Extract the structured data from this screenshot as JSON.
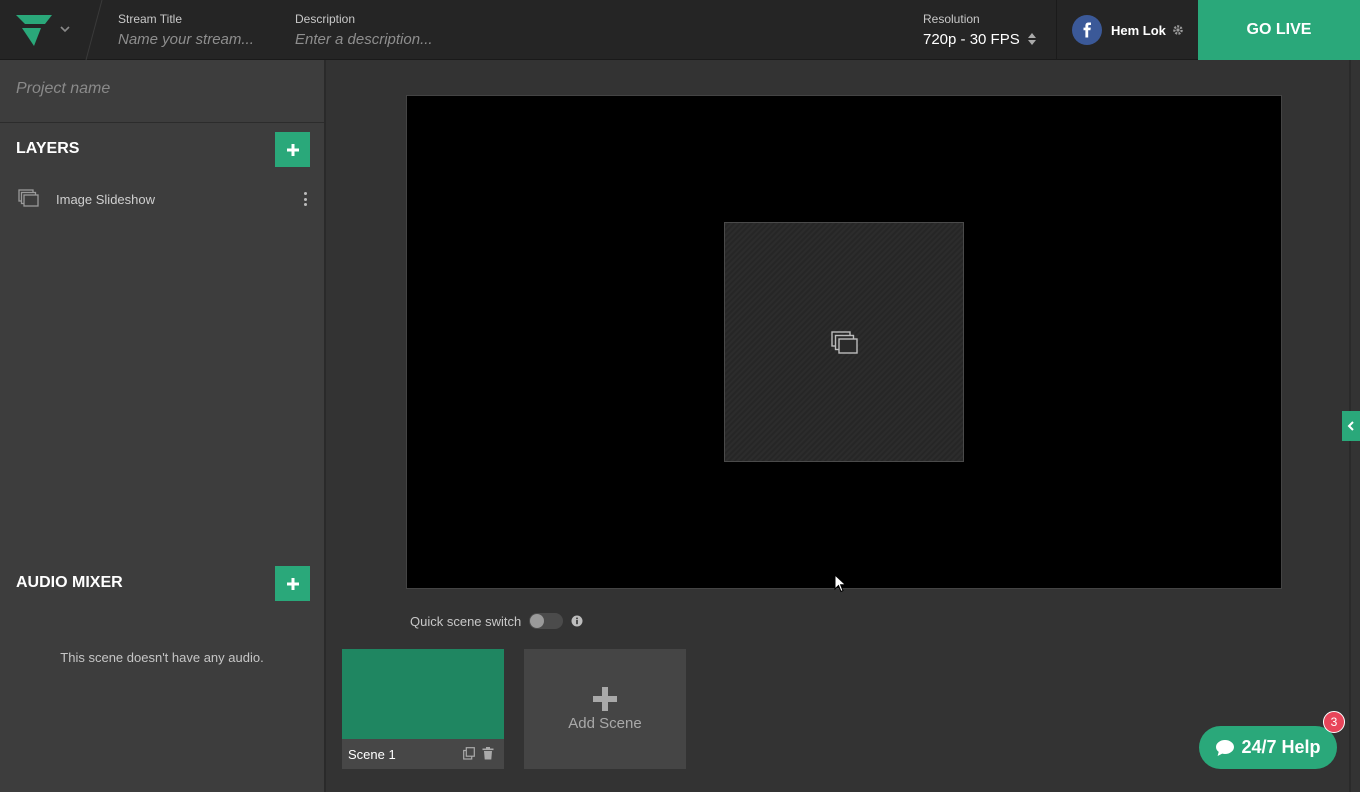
{
  "topbar": {
    "stream_title": {
      "label": "Stream Title",
      "placeholder": "Name your stream..."
    },
    "description": {
      "label": "Description",
      "placeholder": "Enter a description..."
    },
    "resolution": {
      "label": "Resolution",
      "value": "720p - 30 FPS"
    },
    "account": {
      "name": "Hem Lok",
      "platform": "facebook-icon"
    },
    "go_live": "GO LIVE"
  },
  "sidebar": {
    "project": {
      "placeholder": "Project name"
    },
    "layers": {
      "title": "LAYERS",
      "items": [
        {
          "label": "Image Slideshow",
          "icon": "image-slideshow-icon"
        }
      ]
    },
    "audio_mixer": {
      "title": "AUDIO MIXER",
      "empty_text": "This scene doesn't have any audio."
    }
  },
  "main": {
    "quick_switch": {
      "label": "Quick scene switch",
      "enabled": false
    },
    "scenes": [
      {
        "name": "Scene 1",
        "color": "#1f8661",
        "active": true
      }
    ],
    "add_scene": "Add Scene"
  },
  "help": {
    "label": "24/7 Help",
    "badge": "3"
  },
  "colors": {
    "accent": "#2aa87a",
    "background": "#333333",
    "sidebar": "#3d3d3d",
    "topbar": "#252525",
    "badge": "#e8455a"
  }
}
